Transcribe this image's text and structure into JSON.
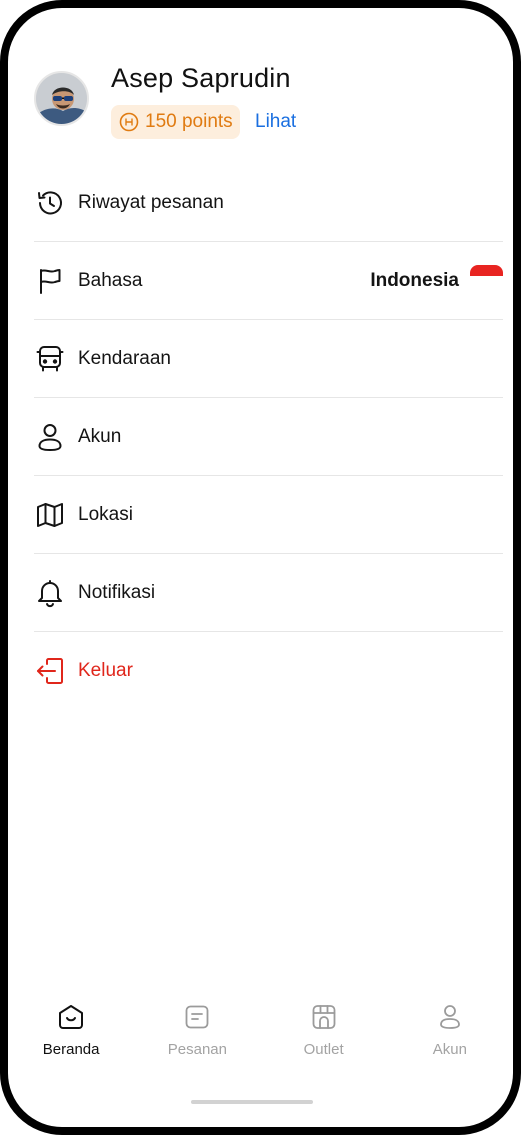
{
  "profile": {
    "name": "Asep Saprudin",
    "points": "150 points",
    "view_link": "Lihat"
  },
  "menu": {
    "items": [
      {
        "label": "Riwayat pesanan",
        "icon": "history-icon"
      },
      {
        "label": "Bahasa",
        "icon": "flag-icon",
        "value": "Indonesia",
        "value_flag": "indonesia-flag"
      },
      {
        "label": "Kendaraan",
        "icon": "bus-icon"
      },
      {
        "label": "Akun",
        "icon": "user-icon"
      },
      {
        "label": "Lokasi",
        "icon": "map-icon"
      },
      {
        "label": "Notifikasi",
        "icon": "bell-icon"
      },
      {
        "label": "Keluar",
        "icon": "logout-icon"
      }
    ]
  },
  "bottom_nav": {
    "items": [
      {
        "label": "Beranda",
        "icon": "home-icon",
        "active": true
      },
      {
        "label": "Pesanan",
        "icon": "orders-icon",
        "active": false
      },
      {
        "label": "Outlet",
        "icon": "store-icon",
        "active": false
      },
      {
        "label": "Akun",
        "icon": "user-icon",
        "active": false
      }
    ]
  },
  "colors": {
    "accent_blue": "#1a6fe0",
    "points_orange": "#e07b12",
    "points_bg": "#fdeedd",
    "danger_red": "#e0261b",
    "flag_red": "#e82421",
    "inactive_gray": "#a3a3a3"
  }
}
